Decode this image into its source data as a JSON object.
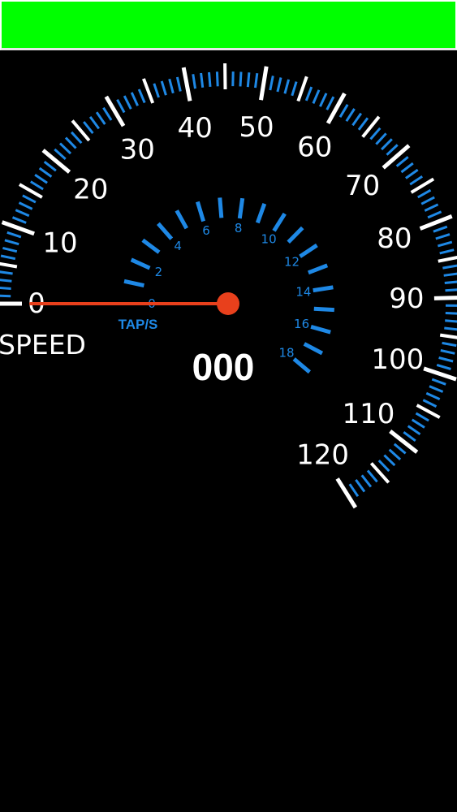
{
  "status_bar": {
    "color": "#00ff00"
  },
  "speedometer": {
    "outer_scale": {
      "labels": [
        "0",
        "10",
        "20",
        "30",
        "40",
        "50",
        "60",
        "70",
        "80",
        "90",
        "100",
        "110",
        "120"
      ]
    },
    "inner_scale": {
      "labels": [
        "0",
        "2",
        "4",
        "6",
        "8",
        "10",
        "12",
        "14",
        "16",
        "18"
      ]
    },
    "unit_label": "TAP/S",
    "speed_label": "SPEED",
    "readout": "000",
    "needle_value": 0,
    "colors": {
      "major_tick": "#ffffff",
      "minor_tick": "#1e88e5",
      "needle": "#e8401c",
      "inner_accent": "#1e88e5"
    }
  }
}
